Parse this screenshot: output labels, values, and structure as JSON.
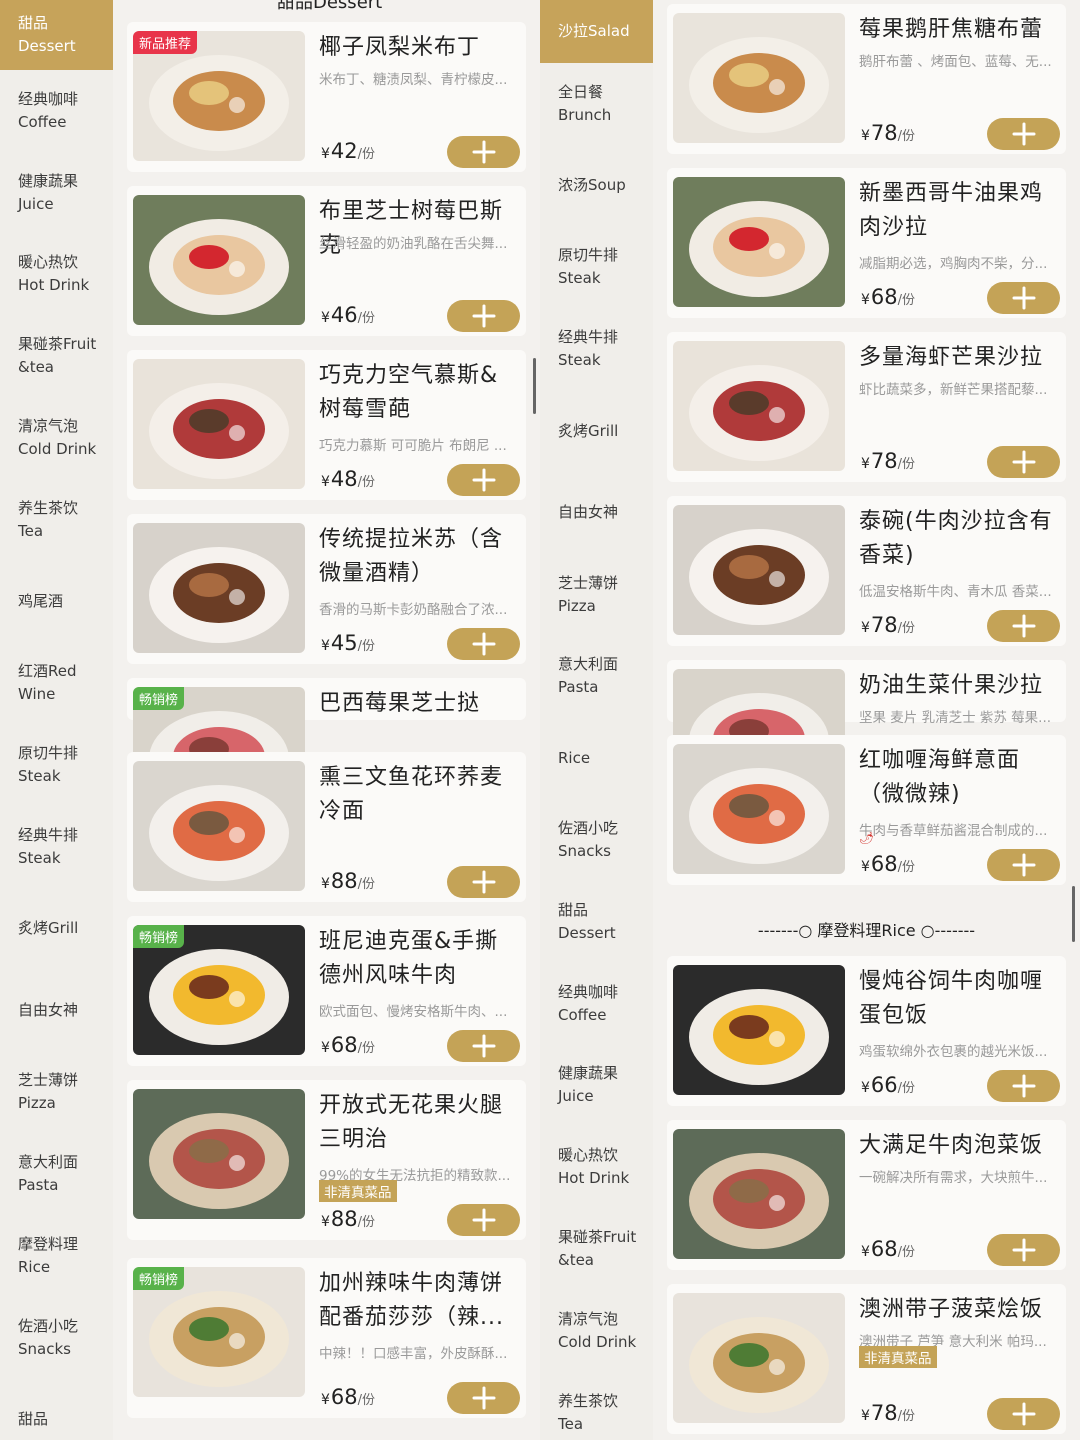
{
  "left_sidebar": {
    "items": [
      {
        "zh": "甜品",
        "en": "Dessert",
        "active": true
      },
      {
        "zh": "经典咖啡",
        "en": "Coffee"
      },
      {
        "zh": "健康蔬果",
        "en": "Juice"
      },
      {
        "zh": "暖心热饮",
        "en": "Hot Drink"
      },
      {
        "zh": "果碰茶Fruit",
        "en": "&tea"
      },
      {
        "zh": "清凉气泡",
        "en": "Cold Drink"
      },
      {
        "zh": "养生茶饮",
        "en": "Tea"
      },
      {
        "zh": "鸡尾酒",
        "en": ""
      },
      {
        "zh": "红酒Red",
        "en": "Wine"
      },
      {
        "zh": "原切牛排",
        "en": "Steak"
      },
      {
        "zh": "经典牛排",
        "en": "Steak"
      },
      {
        "zh": "炙烤Grill",
        "en": ""
      },
      {
        "zh": "自由女神",
        "en": ""
      },
      {
        "zh": "芝士薄饼",
        "en": "Pizza"
      },
      {
        "zh": "意大利面",
        "en": "Pasta"
      },
      {
        "zh": "摩登料理",
        "en": "Rice"
      },
      {
        "zh": "佐酒小吃",
        "en": "Snacks"
      },
      {
        "zh": "甜品",
        "en": ""
      }
    ]
  },
  "right_sidebar": {
    "items": [
      {
        "zh": "沙拉Salad",
        "en": "",
        "active": true
      },
      {
        "zh": "全日餐",
        "en": "Brunch"
      },
      {
        "zh": "浓汤Soup",
        "en": ""
      },
      {
        "zh": "原切牛排",
        "en": "Steak"
      },
      {
        "zh": "经典牛排",
        "en": "Steak"
      },
      {
        "zh": "炙烤Grill",
        "en": ""
      },
      {
        "zh": "自由女神",
        "en": ""
      },
      {
        "zh": "芝士薄饼",
        "en": "Pizza"
      },
      {
        "zh": "意大利面",
        "en": "Pasta"
      },
      {
        "zh": "",
        "en": "Rice"
      },
      {
        "zh": "佐酒小吃",
        "en": "Snacks"
      },
      {
        "zh": "甜品",
        "en": "Dessert"
      },
      {
        "zh": "经典咖啡",
        "en": "Coffee"
      },
      {
        "zh": "健康蔬果",
        "en": "Juice"
      },
      {
        "zh": "暖心热饮",
        "en": "Hot Drink"
      },
      {
        "zh": "果碰茶Fruit",
        "en": "&tea"
      },
      {
        "zh": "清凉气泡",
        "en": "Cold Drink"
      },
      {
        "zh": "养生茶饮",
        "en": "Tea"
      }
    ]
  },
  "top_cut_title": "甜品Dessert",
  "currency": "¥",
  "unit": "/份",
  "left_products": [
    {
      "name": "椰子凤梨米布丁",
      "desc": "米布丁、糖渍凤梨、青柠檬皮...",
      "price": "42",
      "badge": "新品推荐"
    },
    {
      "name": "布里芝士树莓巴斯克",
      "desc": "丝滑轻盈的奶油乳酪在舌尖舞...",
      "price": "46"
    },
    {
      "name": "巧克力空气慕斯&树莓雪葩",
      "desc": "巧克力慕斯 可可脆片 布朗尼 ...",
      "price": "48"
    },
    {
      "name": "传统提拉米苏（含微量酒精）",
      "desc": "香滑的马斯卡彭奶酪融合了浓...",
      "price": "45"
    },
    {
      "name": "巴西莓果芝士挞",
      "badge": "畅销榜"
    },
    {
      "name": "熏三文鱼花环荞麦冷面",
      "desc": "",
      "price": "88"
    },
    {
      "name": "班尼迪克蛋&手撕德州风味牛肉",
      "desc": "欧式面包、慢烤安格斯牛肉、...",
      "price": "68",
      "badge": "畅销榜"
    },
    {
      "name": "开放式无花果火腿三明治",
      "desc": "99%的女生无法抗拒的精致款...",
      "price": "88",
      "tag": "非清真菜品"
    },
    {
      "name": "加州辣味牛肉薄饼配番茄莎莎（辣...",
      "desc": "中辣！！口感丰富，外皮酥酥...",
      "price": "68",
      "badge": "畅销榜"
    }
  ],
  "right_products": [
    {
      "name": "莓果鹅肝焦糖布蕾",
      "desc": "鹅肝布蕾 、烤面包、蓝莓、无...",
      "price": "78"
    },
    {
      "name": "新墨西哥牛油果鸡肉沙拉",
      "desc": "减脂期必选，鸡胸肉不柴，分...",
      "price": "68"
    },
    {
      "name": "多量海虾芒果沙拉",
      "desc": "虾比蔬菜多，新鲜芒果搭配藜...",
      "price": "78"
    },
    {
      "name": "泰碗(牛肉沙拉含有香菜)",
      "desc": "低温安格斯牛肉、青木瓜 香菜...",
      "price": "78"
    },
    {
      "name": "奶油生菜什果沙拉",
      "desc": "坚果 麦片 乳清芝士 紫苏 莓果..."
    },
    {
      "name": "红咖喱海鲜意面（微微辣)",
      "desc": "牛肉与香草鲜茄酱混合制成的...",
      "price": "68",
      "chili": "🌶"
    },
    {
      "name": "慢炖谷饲牛肉咖喱蛋包饭",
      "desc": "鸡蛋软绵外衣包裹的越光米饭...",
      "price": "66"
    },
    {
      "name": "大满足牛肉泡菜饭",
      "desc": "一碗解决所有需求，大块煎牛...",
      "price": "68"
    },
    {
      "name": "澳洲带子菠菜烩饭",
      "desc": "澳洲带子 芦笋 意大利米 帕玛...",
      "price": "78",
      "tag": "非清真菜品"
    }
  ],
  "section_header": "-------○ 摩登料理Rice ○-------"
}
